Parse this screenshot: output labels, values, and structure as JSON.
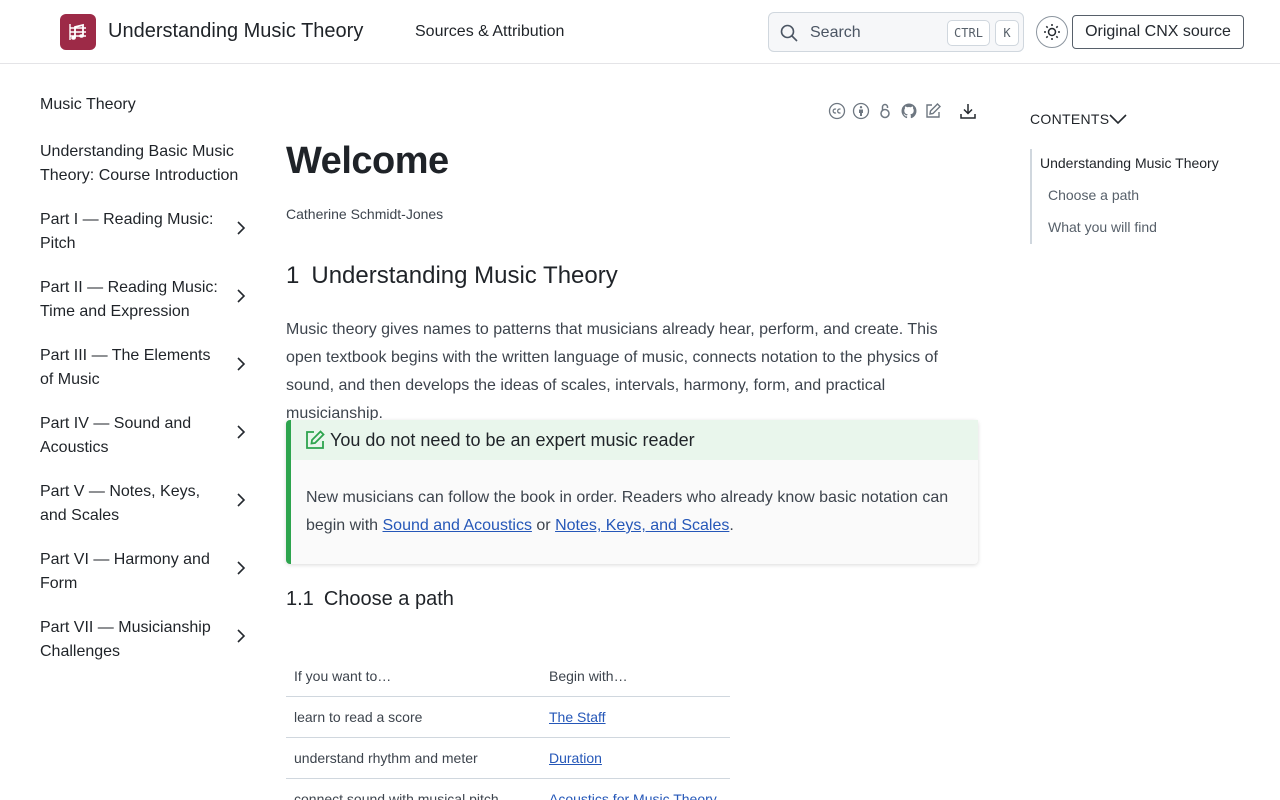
{
  "header": {
    "site_title": "Understanding Music Theory",
    "nav_link": "Sources & Attribution",
    "search_placeholder": "Search",
    "kbd_ctrl": "CTRL",
    "kbd_k": "K",
    "source_button": "Original CNX source"
  },
  "sidebar": {
    "top": "Music Theory",
    "items": [
      {
        "label": "Understanding Basic Music Theory: Course Introduction",
        "expandable": false
      },
      {
        "label": "Part I — Reading Music: Pitch",
        "expandable": true
      },
      {
        "label": "Part II — Reading Music: Time and Expression",
        "expandable": true
      },
      {
        "label": "Part III — The Elements of Music",
        "expandable": true
      },
      {
        "label": "Part IV — Sound and Acoustics",
        "expandable": true
      },
      {
        "label": "Part V — Notes, Keys, and Scales",
        "expandable": true
      },
      {
        "label": "Part VI — Harmony and Form",
        "expandable": true
      },
      {
        "label": "Part VII — Musicianship Challenges",
        "expandable": true
      }
    ]
  },
  "main": {
    "title": "Welcome",
    "author": "Catherine Schmidt-Jones",
    "section": {
      "number": "1",
      "title": "Understanding Music Theory"
    },
    "intro": "Music theory gives names to patterns that musicians already hear, perform, and create. This open textbook begins with the written language of music, connects notation to the physics of sound, and then develops the ideas of scales, intervals, harmony, form, and practical musicianship.",
    "callout": {
      "title": "You do not need to be an expert music reader",
      "body_prefix": "New musicians can follow the book in order. Readers who already know basic notation can begin with ",
      "link1": "Sound and Acoustics",
      "middle": " or ",
      "link2": "Notes, Keys, and Scales",
      "suffix": "."
    },
    "subsection": {
      "number": "1.1",
      "title": "Choose a path"
    },
    "table": {
      "headers": [
        "If you want to…",
        "Begin with…"
      ],
      "rows": [
        {
          "goal": "learn to read a score",
          "start": "The Staff"
        },
        {
          "goal": "understand rhythm and meter",
          "start": "Duration"
        },
        {
          "goal": "connect sound with musical pitch",
          "start": "Acoustics for Music Theory"
        }
      ]
    }
  },
  "toc": {
    "heading": "CONTENTS",
    "items": [
      "Understanding Music Theory",
      "Choose a path",
      "What you will find"
    ]
  },
  "colors": {
    "logo": "#9d2a47",
    "accent_green": "#2da44e",
    "link": "#2557b8"
  }
}
